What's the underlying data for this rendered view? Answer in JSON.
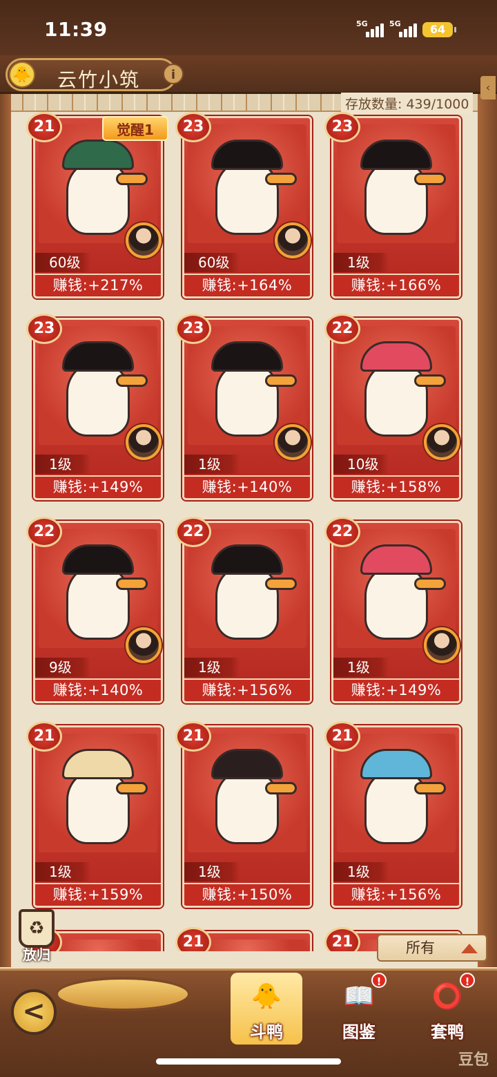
{
  "status": {
    "time": "11:39",
    "signal1": "5G",
    "signal2": "5G",
    "battery": "64"
  },
  "header": {
    "title": "云竹小筑",
    "info": "i",
    "duck_icon": "duck-icon"
  },
  "capacity": "存放数量: 439/1000",
  "cards": [
    {
      "badge": "21",
      "awaken": "觉醒1",
      "level": "60级",
      "earn": "赚钱:+217%",
      "hat": "#2f6a4a",
      "avatar": true
    },
    {
      "badge": "23",
      "level": "60级",
      "earn": "赚钱:+164%",
      "hat": "#1b1414",
      "avatar": true
    },
    {
      "badge": "23",
      "level": "1级",
      "earn": "赚钱:+166%",
      "hat": "#1b1414",
      "avatar": false
    },
    {
      "badge": "23",
      "level": "1级",
      "earn": "赚钱:+149%",
      "hat": "#1b1414",
      "avatar": true
    },
    {
      "badge": "23",
      "level": "1级",
      "earn": "赚钱:+140%",
      "hat": "#1b1414",
      "avatar": true
    },
    {
      "badge": "22",
      "level": "10级",
      "earn": "赚钱:+158%",
      "hat": "#e24a60",
      "avatar": true
    },
    {
      "badge": "22",
      "level": "9级",
      "earn": "赚钱:+140%",
      "hat": "#1b1414",
      "avatar": true
    },
    {
      "badge": "22",
      "level": "1级",
      "earn": "赚钱:+156%",
      "hat": "#1b1414",
      "avatar": false
    },
    {
      "badge": "22",
      "level": "1级",
      "earn": "赚钱:+149%",
      "hat": "#e24a60",
      "avatar": true
    },
    {
      "badge": "21",
      "level": "1级",
      "earn": "赚钱:+159%",
      "hat": "#f0d9a8",
      "avatar": false
    },
    {
      "badge": "21",
      "level": "1级",
      "earn": "赚钱:+150%",
      "hat": "#2b1e1e",
      "avatar": false
    },
    {
      "badge": "21",
      "level": "1级",
      "earn": "赚钱:+156%",
      "hat": "#5fb6d8",
      "avatar": false
    }
  ],
  "partial_cards": [
    {
      "badge": ""
    },
    {
      "badge": "21"
    },
    {
      "badge": "21"
    }
  ],
  "controls": {
    "recycle_label": "放归",
    "filter_value": "所有"
  },
  "nav": {
    "back": "<",
    "tab1": "斗鸭",
    "tab2": "图鉴",
    "tab3": "套鸭",
    "badge": "!"
  },
  "watermark": "豆包"
}
